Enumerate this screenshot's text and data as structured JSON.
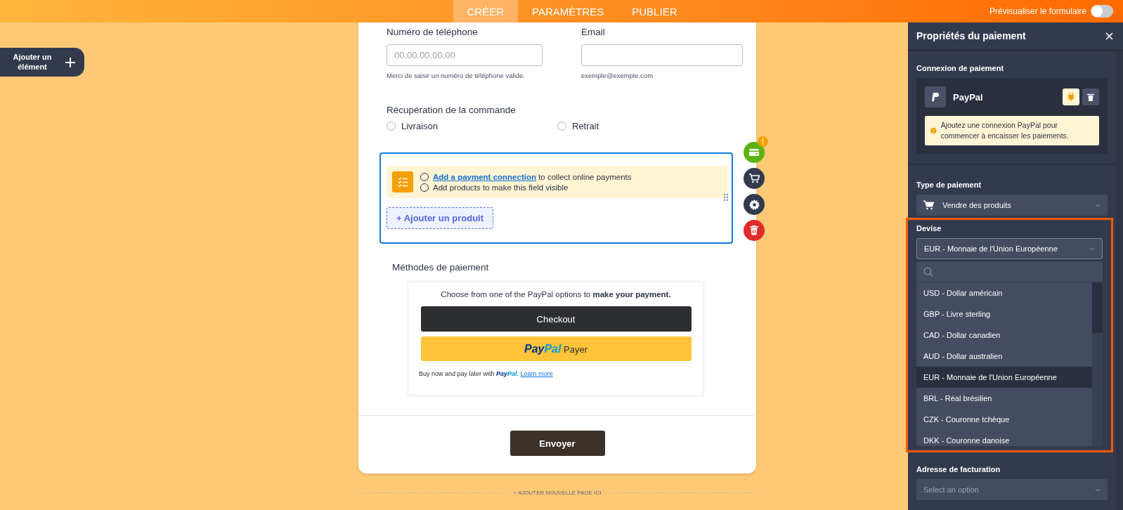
{
  "top_bar": {
    "tabs": [
      {
        "label": "CRÉER",
        "selected": true
      },
      {
        "label": "PARAMÈTRES",
        "selected": false
      },
      {
        "label": "PUBLIER",
        "selected": false
      }
    ],
    "preview_toggle": {
      "label": "Prévisualiser le formulaire",
      "on": false
    }
  },
  "add_element_button": "Ajouter un élément",
  "form": {
    "phone": {
      "label": "Numéro de téléphone",
      "placeholder": "00.00.00.00.00",
      "hint": "Merci de saisir un numéro de téléphone valide."
    },
    "email": {
      "label": "Email",
      "hint": "exemple@exemple.com"
    },
    "pickup": {
      "label": "Récupération de la commande",
      "options": [
        {
          "label": "Livraison",
          "selected": false
        },
        {
          "label": "Retrait",
          "selected": false
        }
      ]
    },
    "payment_field": {
      "notices": [
        {
          "link": "Add a payment connection",
          "text": "to collect online payments",
          "checked": false
        },
        {
          "text": "Add products to make this field visible",
          "checked": false
        }
      ],
      "add_product_button": "+ Ajouter un produit"
    },
    "payment_methods": {
      "label": "Méthodes de paiement",
      "intro": "Choose from one of the PayPal options to **make your payment.**",
      "checkout_button": "Checkout",
      "paypal_button": {
        "brand": [
          "Pay",
          "Pal"
        ],
        "label": "Payer"
      },
      "pay_later": {
        "text": "Buy now and pay later with",
        "brand": [
          "Pay",
          "Pal"
        ],
        "punctuation": ".",
        "link": "Learn more"
      }
    },
    "submit_button": "Envoyer",
    "add_page_link": "+ AJOUTER NOUVELLE PAGE ICI"
  },
  "properties_panel": {
    "title": "Propriétés du paiement",
    "connection": {
      "label": "Connexion de paiement",
      "provider": "PayPal",
      "warning": "Ajoutez une connexion PayPal pour commencer à encaisser les paiements."
    },
    "payment_type": {
      "label": "Type de paiement",
      "value": "Vendre des produits"
    },
    "currency": {
      "label": "Devise",
      "value": "EUR - Monnaie de l'Union Européenne",
      "options": [
        {
          "label": "USD - Dollar américain",
          "selected": false
        },
        {
          "label": "GBP - Livre sterling",
          "selected": false
        },
        {
          "label": "CAD - Dollar canadien",
          "selected": false
        },
        {
          "label": "AUD - Dollar australien",
          "selected": false
        },
        {
          "label": "EUR - Monnaie de l'Union Européenne",
          "selected": true
        },
        {
          "label": "BRL - Réal brésilien",
          "selected": false
        },
        {
          "label": "CZK - Couronne tchèque",
          "selected": false
        },
        {
          "label": "DKK - Couronne danoise",
          "selected": false
        }
      ]
    },
    "billing": {
      "label": "Adresse de facturation",
      "placeholder": "Select an option"
    }
  }
}
